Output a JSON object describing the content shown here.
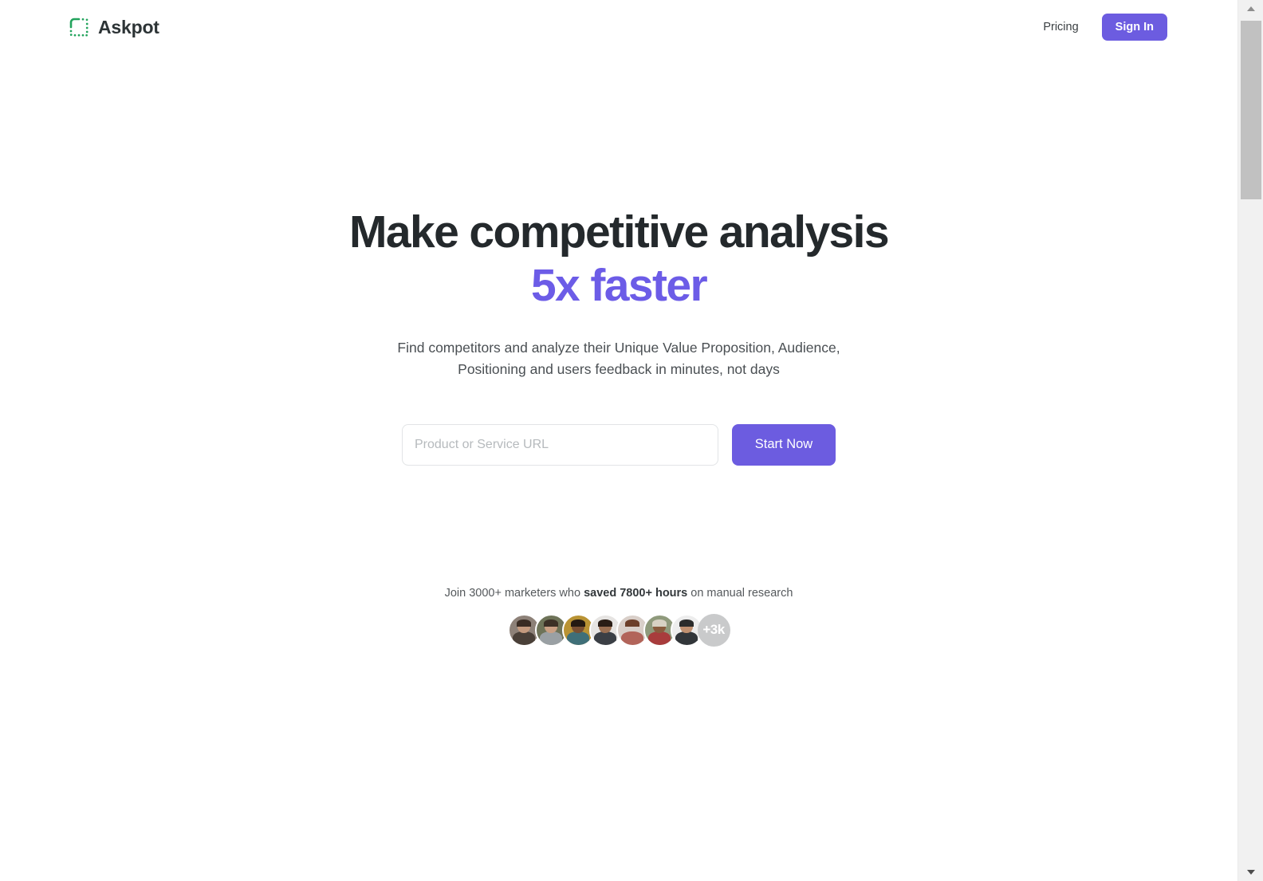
{
  "brand": {
    "name": "Askpot",
    "logo_icon": "dotted-rounded-square-icon",
    "logo_color": "#22a35c"
  },
  "header": {
    "nav_links": [
      {
        "label": "Pricing",
        "name": "pricing"
      }
    ],
    "signin_label": "Sign In",
    "signin_color": "#6c5ce0"
  },
  "hero": {
    "title_line1": "Make competitive analysis",
    "title_line2": "5x faster",
    "accent_color": "#6c5ce7",
    "subtitle_line1": "Find competitors and analyze their Unique Value Proposition, Audience,",
    "subtitle_line2": "Positioning and users feedback in minutes, not days",
    "input_placeholder": "Product or Service URL",
    "input_value": "",
    "cta_label": "Start Now",
    "cta_color": "#6c5ce0"
  },
  "social_proof": {
    "text_before": "Join 3000+ marketers who ",
    "text_bold": "saved 7800+ hours",
    "text_after": " on manual research",
    "more_count_label": "+3k",
    "avatars": [
      {
        "name": "avatar-1",
        "bg": "#8d8178",
        "skin": "#c49a7e",
        "hair": "#3a2c23",
        "body": "#4a4038"
      },
      {
        "name": "avatar-2",
        "bg": "#6e7358",
        "skin": "#c99f83",
        "hair": "#3c3026",
        "body": "#9aa0a4"
      },
      {
        "name": "avatar-3",
        "bg": "#b99334",
        "skin": "#7a5033",
        "hair": "#241a12",
        "body": "#3f6f78"
      },
      {
        "name": "avatar-4",
        "bg": "#e6e4e2",
        "skin": "#9a6f52",
        "hair": "#2a1d16",
        "body": "#3b3f45"
      },
      {
        "name": "avatar-5",
        "bg": "#d9cfc9",
        "skin": "#d9a храни",
        "hair": "#6d3f2a",
        "body": "#b2645a"
      },
      {
        "name": "avatar-6",
        "bg": "#8f9a7c",
        "skin": "#8a5c3e",
        "hair": "#d8d2c4",
        "body": "#a83c3c"
      },
      {
        "name": "avatar-7",
        "bg": "#ededed",
        "skin": "#c09070",
        "hair": "#2b2b2b",
        "body": "#32363a"
      }
    ]
  },
  "scrollbar": {
    "up_arrow_icon": "chevron-up-icon",
    "down_arrow_icon": "chevron-down-icon"
  }
}
